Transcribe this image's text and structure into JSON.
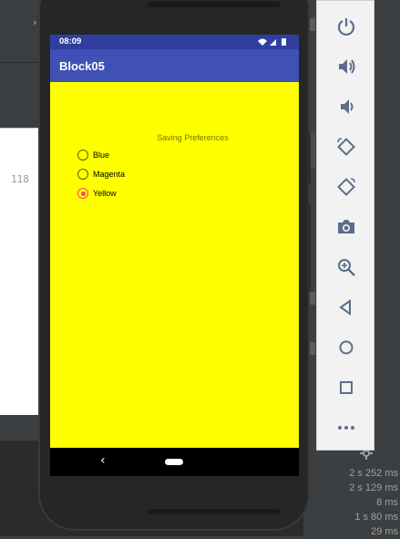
{
  "ide": {
    "line_number": "118",
    "timings": [
      "2 s 252 ms",
      "2 s 129 ms",
      "8 ms",
      "1 s 80 ms",
      "29 ms"
    ],
    "chevron": "›"
  },
  "device": {
    "status_time": "08:09",
    "app_title": "Block05",
    "section_label": "Saving Preferences",
    "radio_options": [
      {
        "label": "Blue",
        "checked": false
      },
      {
        "label": "Magenta",
        "checked": false
      },
      {
        "label": "Yellow",
        "checked": true
      }
    ],
    "background_color": "#ffff00",
    "appbar_color": "#3f51b5",
    "statusbar_color": "#303f9f",
    "accent_color": "#ff4081",
    "nav_back_glyph": "‹"
  },
  "emulator_toolbar": {
    "buttons": [
      "power-icon",
      "volume-up-icon",
      "volume-down-icon",
      "rotate-left-icon",
      "rotate-right-icon",
      "camera-icon",
      "zoom-icon",
      "back-icon",
      "home-icon",
      "overview-icon",
      "more-icon"
    ],
    "icon_color": "#5a6e8c"
  }
}
